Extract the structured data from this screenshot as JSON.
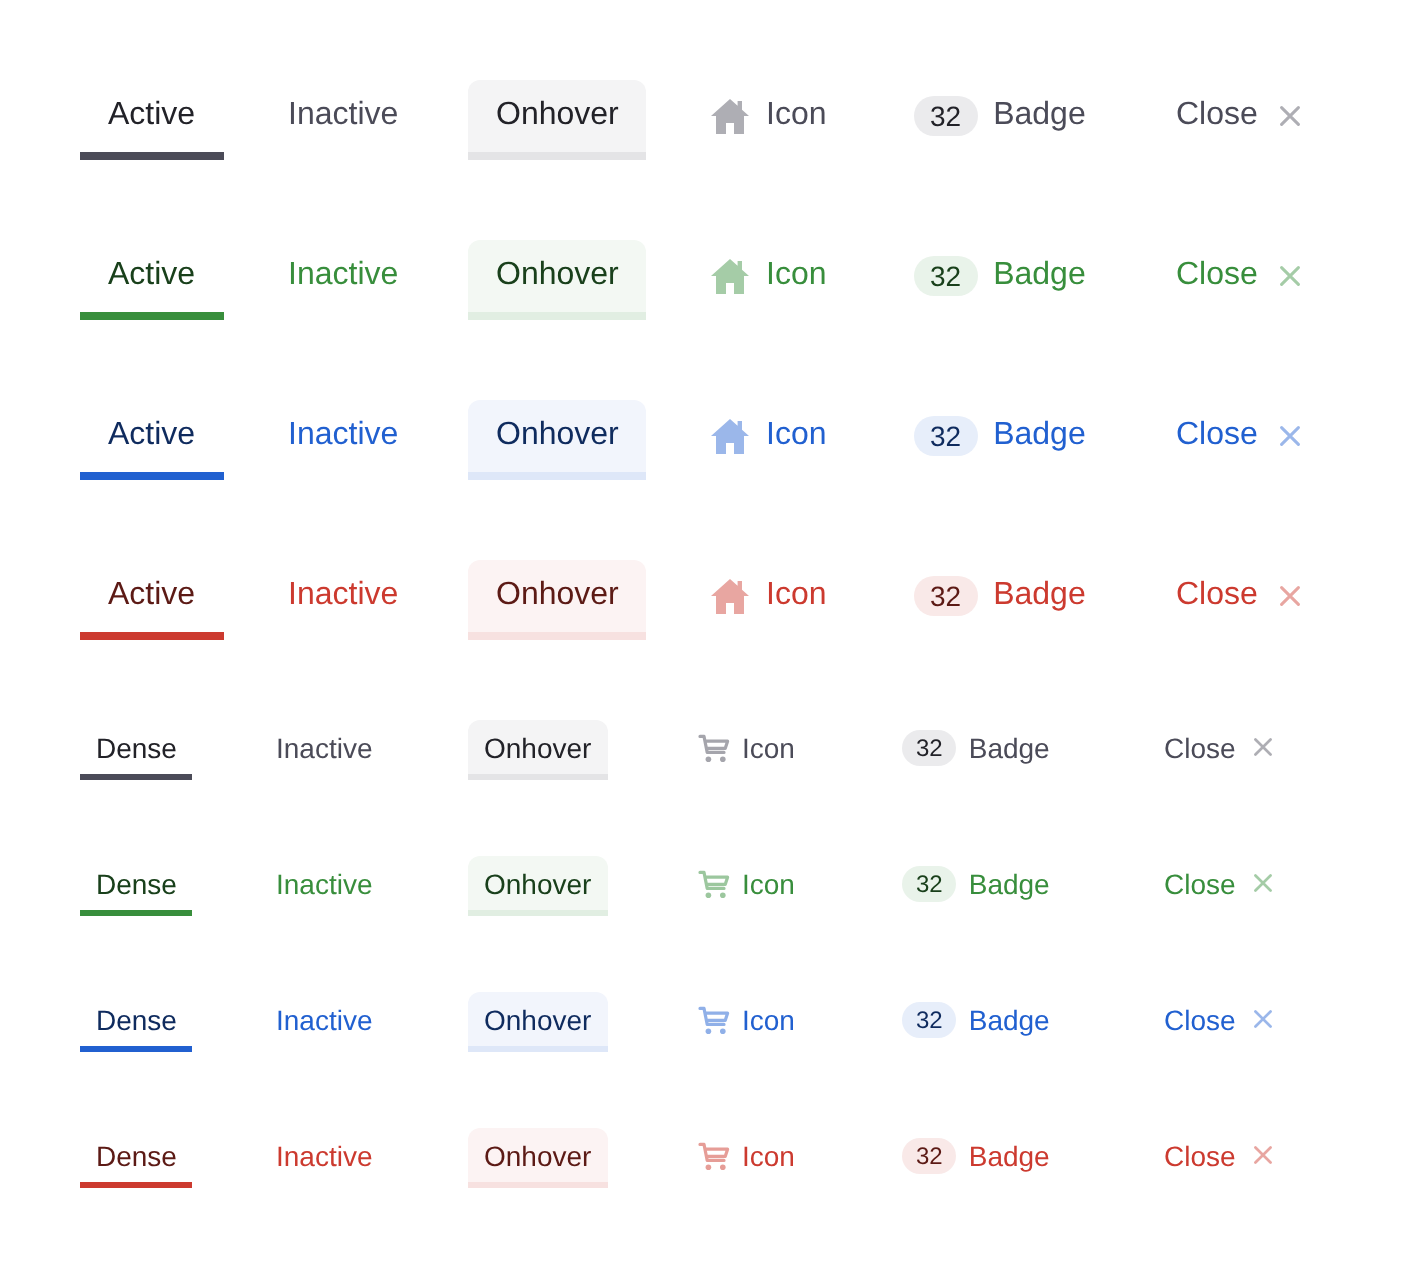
{
  "tab_bars": [
    {
      "color": "#4b4b58",
      "dense": false,
      "tabs": [
        {
          "kind": "plain",
          "label": "Active",
          "selected": true,
          "hovered": false
        },
        {
          "kind": "plain",
          "label": "Inactive",
          "selected": false,
          "hovered": false
        },
        {
          "kind": "plain",
          "label": "Onhover",
          "selected": false,
          "hovered": true
        },
        {
          "kind": "icon",
          "label": "Icon",
          "selected": false,
          "hovered": false
        },
        {
          "kind": "badge",
          "label": "Badge",
          "badge": "32",
          "selected": false,
          "hovered": false
        },
        {
          "kind": "closable",
          "label": "Close",
          "selected": false,
          "hovered": false
        }
      ]
    },
    {
      "color": "#388e3c",
      "dense": false,
      "tabs": [
        {
          "kind": "plain",
          "label": "Active",
          "selected": true,
          "hovered": false
        },
        {
          "kind": "plain",
          "label": "Inactive",
          "selected": false,
          "hovered": false
        },
        {
          "kind": "plain",
          "label": "Onhover",
          "selected": false,
          "hovered": true
        },
        {
          "kind": "icon",
          "label": "Icon",
          "selected": false,
          "hovered": false
        },
        {
          "kind": "badge",
          "label": "Badge",
          "badge": "32",
          "selected": false,
          "hovered": false
        },
        {
          "kind": "closable",
          "label": "Close",
          "selected": false,
          "hovered": false
        }
      ]
    },
    {
      "color": "#2160d0",
      "dense": false,
      "tabs": [
        {
          "kind": "plain",
          "label": "Active",
          "selected": true,
          "hovered": false
        },
        {
          "kind": "plain",
          "label": "Inactive",
          "selected": false,
          "hovered": false
        },
        {
          "kind": "plain",
          "label": "Onhover",
          "selected": false,
          "hovered": true
        },
        {
          "kind": "icon",
          "label": "Icon",
          "selected": false,
          "hovered": false
        },
        {
          "kind": "badge",
          "label": "Badge",
          "badge": "32",
          "selected": false,
          "hovered": false
        },
        {
          "kind": "closable",
          "label": "Close",
          "selected": false,
          "hovered": false
        }
      ]
    },
    {
      "color": "#cc3a2f",
      "dense": false,
      "tabs": [
        {
          "kind": "plain",
          "label": "Active",
          "selected": true,
          "hovered": false
        },
        {
          "kind": "plain",
          "label": "Inactive",
          "selected": false,
          "hovered": false
        },
        {
          "kind": "plain",
          "label": "Onhover",
          "selected": false,
          "hovered": true
        },
        {
          "kind": "icon",
          "label": "Icon",
          "selected": false,
          "hovered": false
        },
        {
          "kind": "badge",
          "label": "Badge",
          "badge": "32",
          "selected": false,
          "hovered": false
        },
        {
          "kind": "closable",
          "label": "Close",
          "selected": false,
          "hovered": false
        }
      ]
    },
    {
      "color": "#4b4b58",
      "dense": true,
      "tabs": [
        {
          "kind": "plain",
          "label": "Dense",
          "selected": true,
          "hovered": false
        },
        {
          "kind": "plain",
          "label": "Inactive",
          "selected": false,
          "hovered": false
        },
        {
          "kind": "plain",
          "label": "Onhover",
          "selected": false,
          "hovered": true
        },
        {
          "kind": "icon",
          "label": "Icon",
          "selected": false,
          "hovered": false
        },
        {
          "kind": "badge",
          "label": "Badge",
          "badge": "32",
          "selected": false,
          "hovered": false
        },
        {
          "kind": "closable",
          "label": "Close",
          "selected": false,
          "hovered": false
        }
      ]
    },
    {
      "color": "#388e3c",
      "dense": true,
      "tabs": [
        {
          "kind": "plain",
          "label": "Dense",
          "selected": true,
          "hovered": false
        },
        {
          "kind": "plain",
          "label": "Inactive",
          "selected": false,
          "hovered": false
        },
        {
          "kind": "plain",
          "label": "Onhover",
          "selected": false,
          "hovered": true
        },
        {
          "kind": "icon",
          "label": "Icon",
          "selected": false,
          "hovered": false
        },
        {
          "kind": "badge",
          "label": "Badge",
          "badge": "32",
          "selected": false,
          "hovered": false
        },
        {
          "kind": "closable",
          "label": "Close",
          "selected": false,
          "hovered": false
        }
      ]
    },
    {
      "color": "#2160d0",
      "dense": true,
      "tabs": [
        {
          "kind": "plain",
          "label": "Dense",
          "selected": true,
          "hovered": false
        },
        {
          "kind": "plain",
          "label": "Inactive",
          "selected": false,
          "hovered": false
        },
        {
          "kind": "plain",
          "label": "Onhover",
          "selected": false,
          "hovered": true
        },
        {
          "kind": "icon",
          "label": "Icon",
          "selected": false,
          "hovered": false
        },
        {
          "kind": "badge",
          "label": "Badge",
          "badge": "32",
          "selected": false,
          "hovered": false
        },
        {
          "kind": "closable",
          "label": "Close",
          "selected": false,
          "hovered": false
        }
      ]
    },
    {
      "color": "#cc3a2f",
      "dense": true,
      "tabs": [
        {
          "kind": "plain",
          "label": "Dense",
          "selected": true,
          "hovered": false
        },
        {
          "kind": "plain",
          "label": "Inactive",
          "selected": false,
          "hovered": false
        },
        {
          "kind": "plain",
          "label": "Onhover",
          "selected": false,
          "hovered": true
        },
        {
          "kind": "icon",
          "label": "Icon",
          "selected": false,
          "hovered": false
        },
        {
          "kind": "badge",
          "label": "Badge",
          "badge": "32",
          "selected": false,
          "hovered": false
        },
        {
          "kind": "closable",
          "label": "Close",
          "selected": false,
          "hovered": false
        }
      ]
    }
  ]
}
